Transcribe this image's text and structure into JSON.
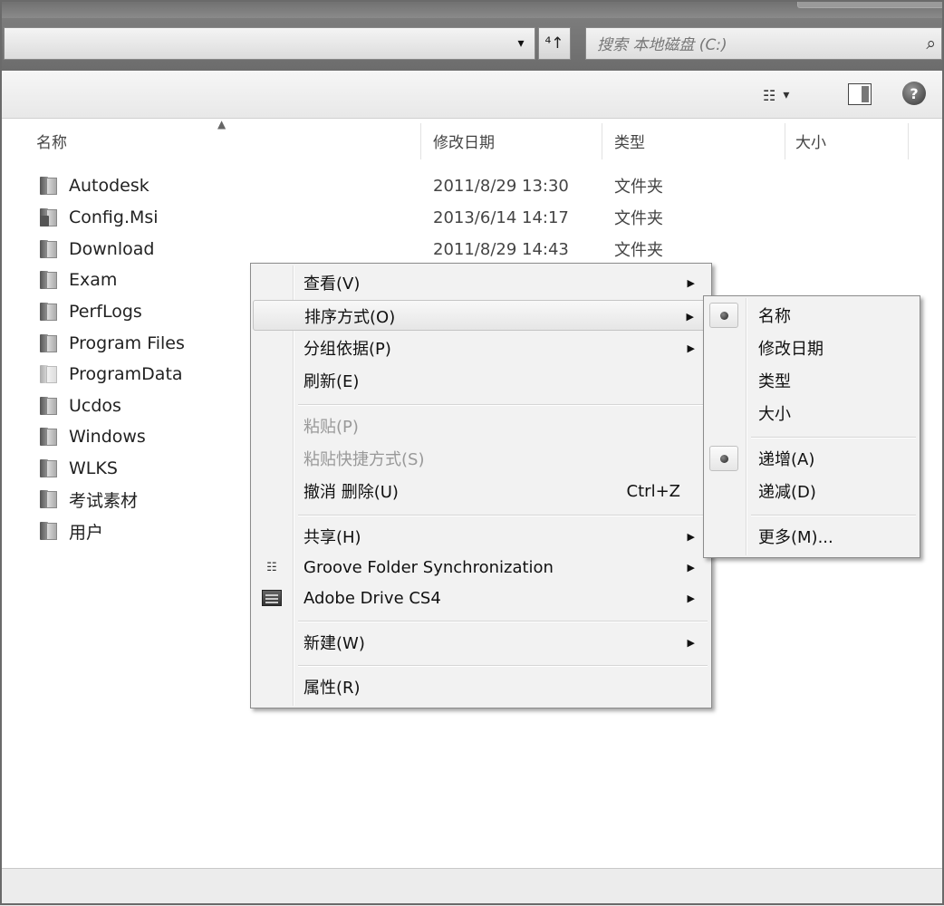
{
  "address": {
    "dropdown_glyph": "▾",
    "refresh_glyph": "⁴↑",
    "search_placeholder": "搜索 本地磁盘 (C:)"
  },
  "toolbar": {
    "views_glyph": "☷",
    "views_dropdown": "▾",
    "help_label": "?"
  },
  "columns": {
    "name": "名称",
    "date": "修改日期",
    "type": "类型",
    "size": "大小"
  },
  "files": [
    {
      "name": "Autodesk",
      "date": "2011/8/29 13:30",
      "type": "文件夹"
    },
    {
      "name": "Config.Msi",
      "date": "2013/6/14 14:17",
      "type": "文件夹",
      "locked": true
    },
    {
      "name": "Download",
      "date": "2011/8/29 14:43",
      "type": "文件夹"
    },
    {
      "name": "Exam",
      "date": "",
      "type": ""
    },
    {
      "name": "PerfLogs",
      "date": "",
      "type": ""
    },
    {
      "name": "Program Files",
      "date": "",
      "type": ""
    },
    {
      "name": "ProgramData",
      "date": "",
      "type": "",
      "hidden": true
    },
    {
      "name": "Ucdos",
      "date": "",
      "type": ""
    },
    {
      "name": "Windows",
      "date": "",
      "type": ""
    },
    {
      "name": "WLKS",
      "date": "",
      "type": ""
    },
    {
      "name": "考试素材",
      "date": "",
      "type": ""
    },
    {
      "name": "用户",
      "date": "",
      "type": ""
    }
  ],
  "context_menu": {
    "view": "查看(V)",
    "sort_by": "排序方式(O)",
    "group_by": "分组依据(P)",
    "refresh": "刷新(E)",
    "paste": "粘贴(P)",
    "paste_shortcut": "粘贴快捷方式(S)",
    "undo_delete": "撤消 删除(U)",
    "undo_shortcut": "Ctrl+Z",
    "share": "共享(H)",
    "groove": "Groove Folder Synchronization",
    "adobe_drive": "Adobe Drive CS4",
    "new": "新建(W)",
    "properties": "属性(R)",
    "arrow": "▶"
  },
  "sort_submenu": {
    "name": "名称",
    "date": "修改日期",
    "type": "类型",
    "size": "大小",
    "ascending": "递增(A)",
    "descending": "递减(D)",
    "more": "更多(M)..."
  }
}
